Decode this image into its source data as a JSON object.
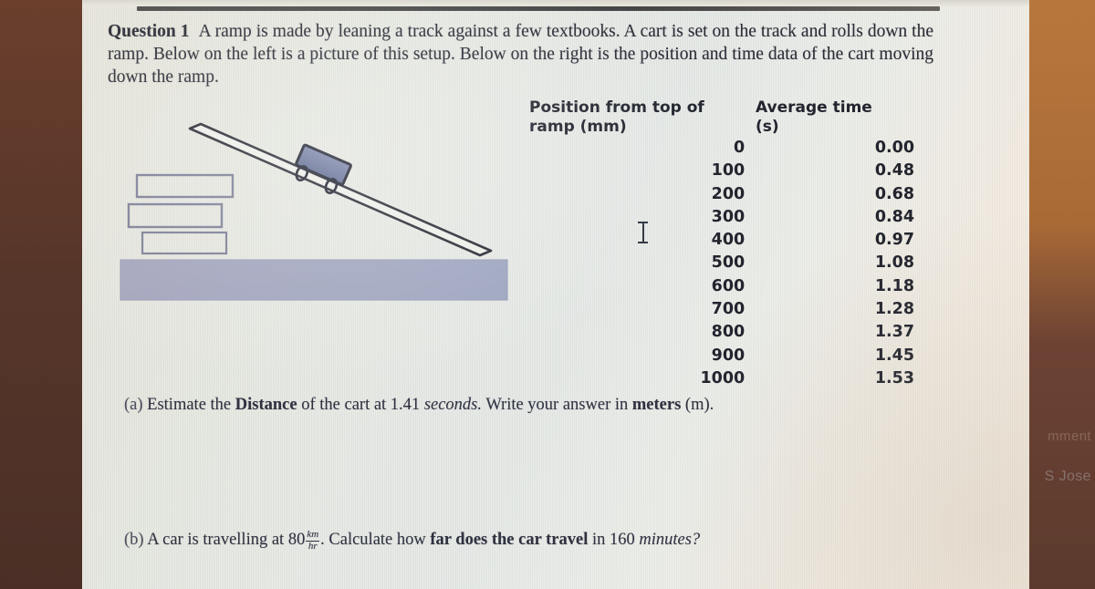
{
  "document": {
    "question_label": "Question 1",
    "intro_text": "A ramp is made by leaning a track against a few textbooks. A cart is set on the track and rolls down the ramp. Below on the left is a picture of this setup. Below on the right is the position and time data of the cart moving down the ramp."
  },
  "table": {
    "header_position": "Position from top of ramp (mm)",
    "header_position_line1": "Position from top of",
    "header_position_line2": "ramp (mm)",
    "header_time_line1": "Average time",
    "header_time_line2": "(s)",
    "rows": [
      {
        "position": "0",
        "time": "0.00"
      },
      {
        "position": "100",
        "time": "0.48"
      },
      {
        "position": "200",
        "time": "0.68"
      },
      {
        "position": "300",
        "time": "0.84"
      },
      {
        "position": "400",
        "time": "0.97"
      },
      {
        "position": "500",
        "time": "1.08"
      },
      {
        "position": "600",
        "time": "1.18"
      },
      {
        "position": "700",
        "time": "1.28"
      },
      {
        "position": "800",
        "time": "1.37"
      },
      {
        "position": "900",
        "time": "1.45"
      },
      {
        "position": "1000",
        "time": "1.53"
      }
    ]
  },
  "part_a": {
    "label": "(a)",
    "t1": "Estimate the",
    "bold1": "Distance",
    "t2": "of the cart at 1.41",
    "ital1": "seconds.",
    "t3": "Write your answer in",
    "bold2": "meters",
    "t4": "(m)."
  },
  "part_b": {
    "label": "(b)",
    "t1": "A car is travelling at 80",
    "frac_num": "km",
    "frac_den": "hr",
    "t2": ". Calculate how",
    "bold1": "far does the car travel",
    "t3": "in 160",
    "ital1": "minutes?"
  },
  "figure": {
    "ramp_label": "inclined-track",
    "cart_label": "cart",
    "books_label": "stack-of-textbooks",
    "table_surface_label": "table-surface"
  },
  "background_text": {
    "right_1": "mment",
    "right_2": "S Jose"
  },
  "colors": {
    "screen_paper": "#e7eae4",
    "ink": "#2b2c36",
    "cart_fill": "#6f7ba0",
    "cart_stroke": "#22242e",
    "book_stroke": "#7d7f97",
    "table_fill": "#a3a6bd",
    "desk_left": "#57362a",
    "desk_right": "#a96a36"
  }
}
